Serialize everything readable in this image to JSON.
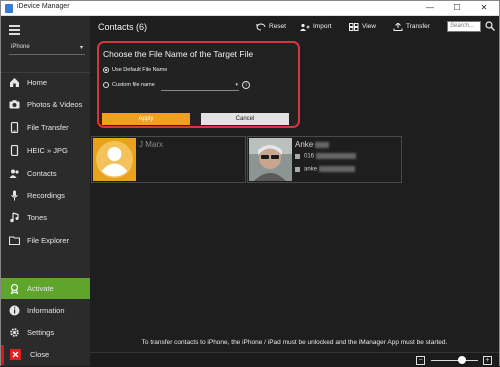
{
  "window": {
    "title": "iDevice Manager",
    "minimize": "—",
    "maximize": "☐",
    "close": "✕"
  },
  "sidebar": {
    "device": "iPhone",
    "items": [
      {
        "label": "Home"
      },
      {
        "label": "Photos & Videos"
      },
      {
        "label": "File Transfer"
      },
      {
        "label": "HEIC » JPG"
      },
      {
        "label": "Contacts"
      },
      {
        "label": "Recordings"
      },
      {
        "label": "Tones"
      },
      {
        "label": "File Explorer"
      }
    ],
    "bottom_items": [
      {
        "label": "Activate"
      },
      {
        "label": "Information"
      },
      {
        "label": "Settings"
      },
      {
        "label": "Close"
      }
    ],
    "colors": {
      "activate": "#5fa52b",
      "close": "#d21a1a"
    }
  },
  "header": {
    "title": "Contacts (6)",
    "actions": [
      {
        "label": "Reset",
        "icon": "reset-icon"
      },
      {
        "label": "Import",
        "icon": "import-icon"
      },
      {
        "label": "View",
        "icon": "grid-icon"
      },
      {
        "label": "Transfer",
        "icon": "transfer-icon"
      }
    ],
    "search_placeholder": "Search..."
  },
  "dialog": {
    "title": "Choose the File Name of the Target File",
    "option_default": "Use Default File Name",
    "option_custom": "Custom file name",
    "custom_value": "",
    "apply": "Apply",
    "cancel": "Cancel",
    "accent": "#f0a020",
    "border": "#d9333f"
  },
  "contacts": [
    {
      "name": "J Marx"
    },
    {
      "name": "Anke",
      "phone_prefix": "016",
      "email_prefix": "anke"
    }
  ],
  "footer": {
    "message": "To transfer contacts to iPhone, the iPhone / iPad must be unlocked and the iManager App must be started.",
    "zoom": {
      "minus": "−",
      "plus": "+",
      "level": 0.66
    }
  }
}
